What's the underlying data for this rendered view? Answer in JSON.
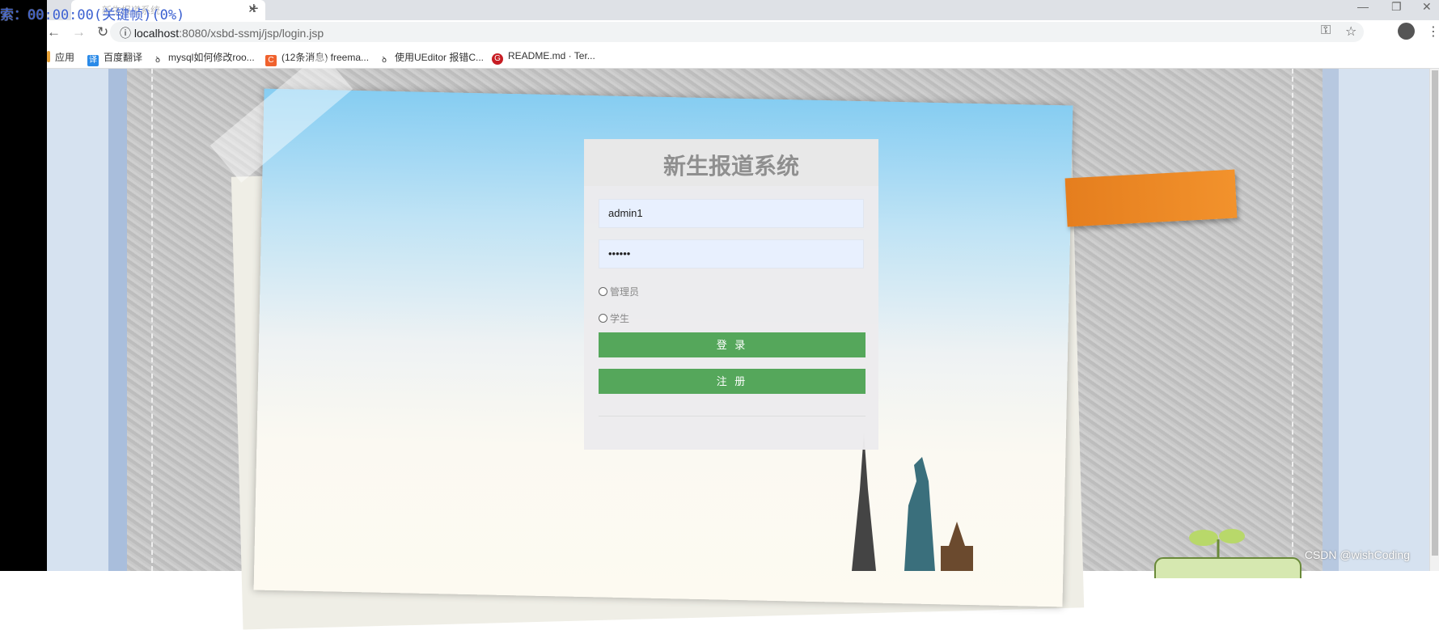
{
  "overlay": "索：00:00:00(关键帧)(0%)",
  "browser": {
    "tab_title": "新生报道系统",
    "url_host": "localhost",
    "url_path": ":8080/xsbd-ssmj/jsp/login.jsp",
    "bookmarks": [
      "应用",
      "百度翻译",
      "mysql如何修改roo...",
      "(12条消息) freema...",
      "使用UEditor 报错C...",
      "README.md · Ter..."
    ]
  },
  "login": {
    "title": "新生报道系统",
    "username": "admin1",
    "password": "••••••",
    "roles": [
      "管理员",
      "学生"
    ],
    "login_label": "登 录",
    "register_label": "注 册"
  },
  "watermark": "CSDN @wishCoding"
}
